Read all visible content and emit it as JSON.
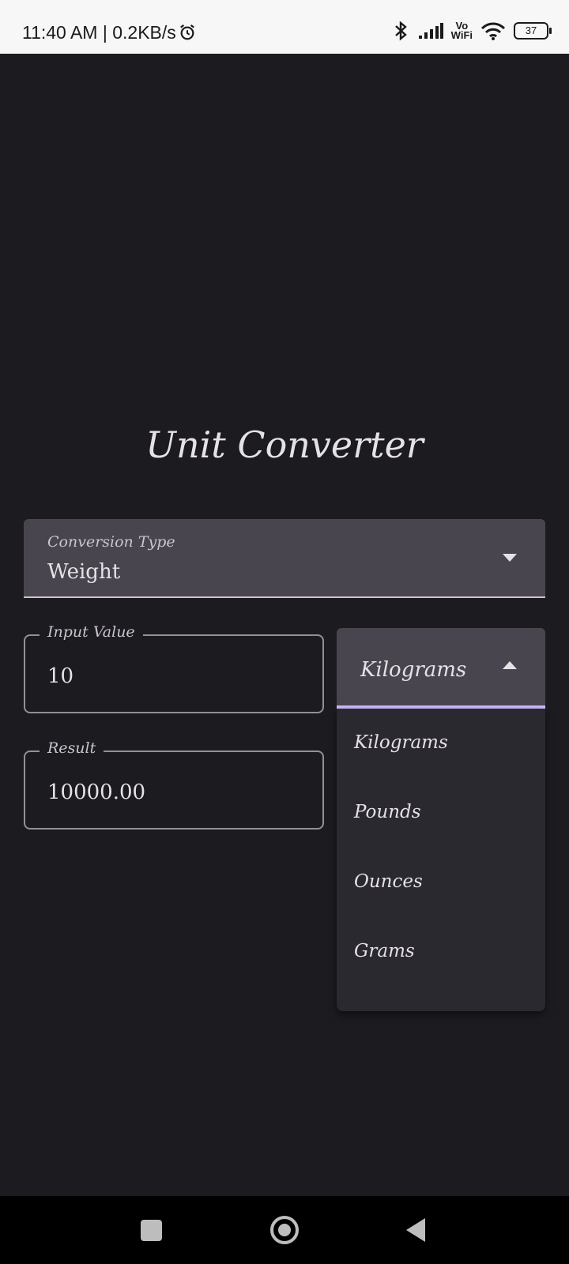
{
  "status_bar": {
    "time": "11:40 AM | 0.2KB/s",
    "vowifi_top": "Vo",
    "vowifi_bottom": "WiFi",
    "battery": "37",
    "icons": [
      "alarm-icon",
      "bluetooth-icon",
      "signal-icon",
      "vowifi-icon",
      "wifi-icon",
      "battery-icon"
    ]
  },
  "app": {
    "title": "Unit Converter",
    "conversion_type": {
      "label": "Conversion Type",
      "value": "Weight"
    },
    "input": {
      "label": "Input Value",
      "value": "10"
    },
    "result": {
      "label": "Result",
      "value": "10000.00"
    },
    "unit_select": {
      "value": "Kilograms",
      "options": [
        "Kilograms",
        "Pounds",
        "Ounces",
        "Grams"
      ]
    }
  },
  "nav_bar": {
    "icons": [
      "recents-icon",
      "home-icon",
      "back-icon"
    ]
  },
  "colors": {
    "background": "#1c1b1f",
    "field": "#49454f",
    "accent": "#cfbcff",
    "menu": "#2b2930"
  }
}
